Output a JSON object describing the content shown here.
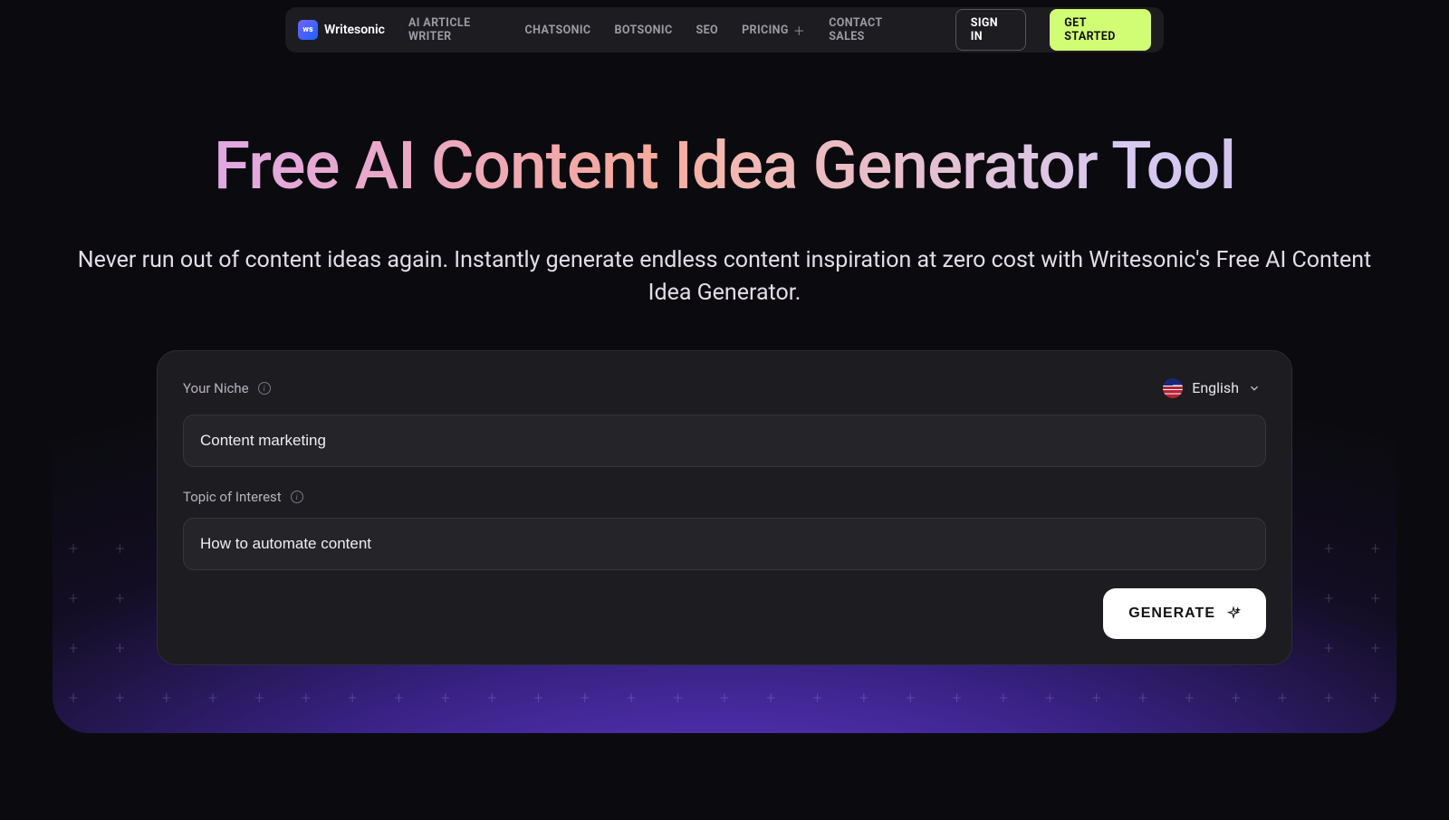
{
  "brand": {
    "name": "Writesonic",
    "mark": "ws"
  },
  "nav": {
    "items": [
      {
        "label": "AI ARTICLE WRITER"
      },
      {
        "label": "CHATSONIC"
      },
      {
        "label": "BOTSONIC"
      },
      {
        "label": "SEO"
      },
      {
        "label": "PRICING",
        "has_plus": true
      },
      {
        "label": "CONTACT SALES"
      }
    ],
    "signin": "SIGN IN",
    "get_started": "GET STARTED"
  },
  "hero": {
    "title": "Free AI Content Idea Generator Tool",
    "subtitle": "Never run out of content ideas again. Instantly generate endless content inspiration at zero cost with Writesonic's Free AI Content Idea Generator."
  },
  "form": {
    "niche_label": "Your Niche",
    "niche_value": "Content marketing",
    "topic_label": "Topic of Interest",
    "topic_value": "How to automate content",
    "language": "English",
    "generate": "GENERATE"
  }
}
